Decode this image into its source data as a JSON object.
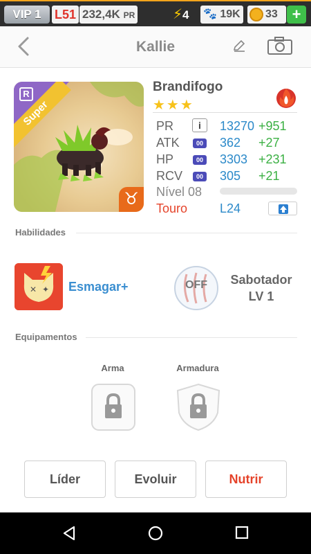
{
  "status": {
    "vip": "VIP 1",
    "level": "L51",
    "power": "232,4K",
    "power_unit": "PR",
    "energy": "4",
    "paws": "19K",
    "coins": "33",
    "colors": {
      "accent": "#f4a51c",
      "plus": "#3fbf4a"
    }
  },
  "header": {
    "title": "Kallie"
  },
  "card": {
    "rarity_letter": "R",
    "grade": "Super",
    "zodiac_icon": "taurus-icon"
  },
  "monster": {
    "name": "Brandifogo",
    "stars": "★★★",
    "element": "fire-icon",
    "stats": [
      {
        "label": "PR",
        "value": "13270",
        "bonus": "+951"
      },
      {
        "label": "ATK",
        "badge": "00",
        "value": "362",
        "bonus": "+27"
      },
      {
        "label": "HP",
        "badge": "00",
        "value": "3303",
        "bonus": "+231"
      },
      {
        "label": "RCV",
        "badge": "00",
        "value": "305",
        "bonus": "+21"
      }
    ],
    "level_label": "Nível 08",
    "xp_progress": 0,
    "sign": "Touro",
    "level_cap": "L24"
  },
  "skills": {
    "section_label": "Habilidades",
    "skill1": "Esmagar+",
    "off_label": "OFF",
    "skill2_name": "Sabotador",
    "skill2_level": "LV 1"
  },
  "equipment": {
    "section_label": "Equipamentos",
    "weapon_label": "Arma",
    "armor_label": "Armadura"
  },
  "actions": {
    "leader": "Líder",
    "evolve": "Evoluir",
    "feed": "Nutrir"
  }
}
